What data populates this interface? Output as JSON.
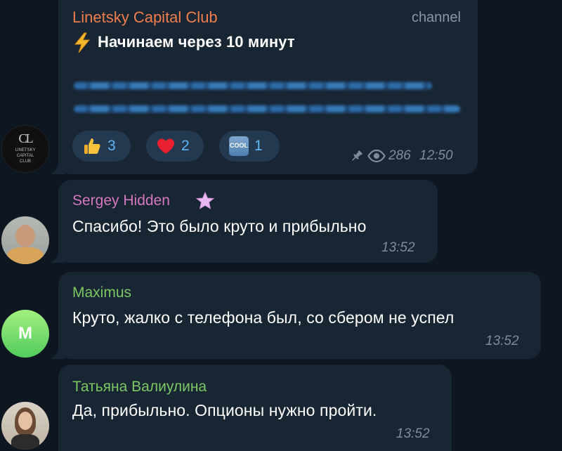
{
  "messages": [
    {
      "sender": "Linetsky Capital Club",
      "badge": "channel",
      "icon": "lightning-icon",
      "text": "Начинаем через 10 минут",
      "reactions": [
        {
          "icon": "thumbs-up-icon",
          "count": "3"
        },
        {
          "icon": "red-heart-icon",
          "count": "2"
        },
        {
          "icon": "cool-icon",
          "label": "COOL",
          "count": "1"
        }
      ],
      "views": "286",
      "time": "12:50",
      "avatar_text": [
        "LINETSKY",
        "CAPITAL",
        "CLUB"
      ],
      "avatar_monogram": "CL"
    },
    {
      "sender": "Sergey Hidden",
      "text": "Спасибо! Это было круто и прибыльно",
      "time": "13:52"
    },
    {
      "sender": "Maximus",
      "text": "Круто, жалко с телефона был, со сбером не успел",
      "time": "13:52",
      "avatar_letter": "M"
    },
    {
      "sender": "Татьяна Валиулина",
      "text": "Да, прибыльно. Опционы нужно пройти.",
      "time": "13:52"
    }
  ],
  "colors": {
    "background": "#0e1621",
    "bubble": "#182533",
    "channel_name": "#ef7e4d",
    "sergey_name": "#d678c0",
    "maximus_name": "#7bc862",
    "tatyana_name": "#7bc862",
    "reaction_bg": "#23394f",
    "reaction_count": "#5fb4f5",
    "meta": "#7e8b98"
  }
}
